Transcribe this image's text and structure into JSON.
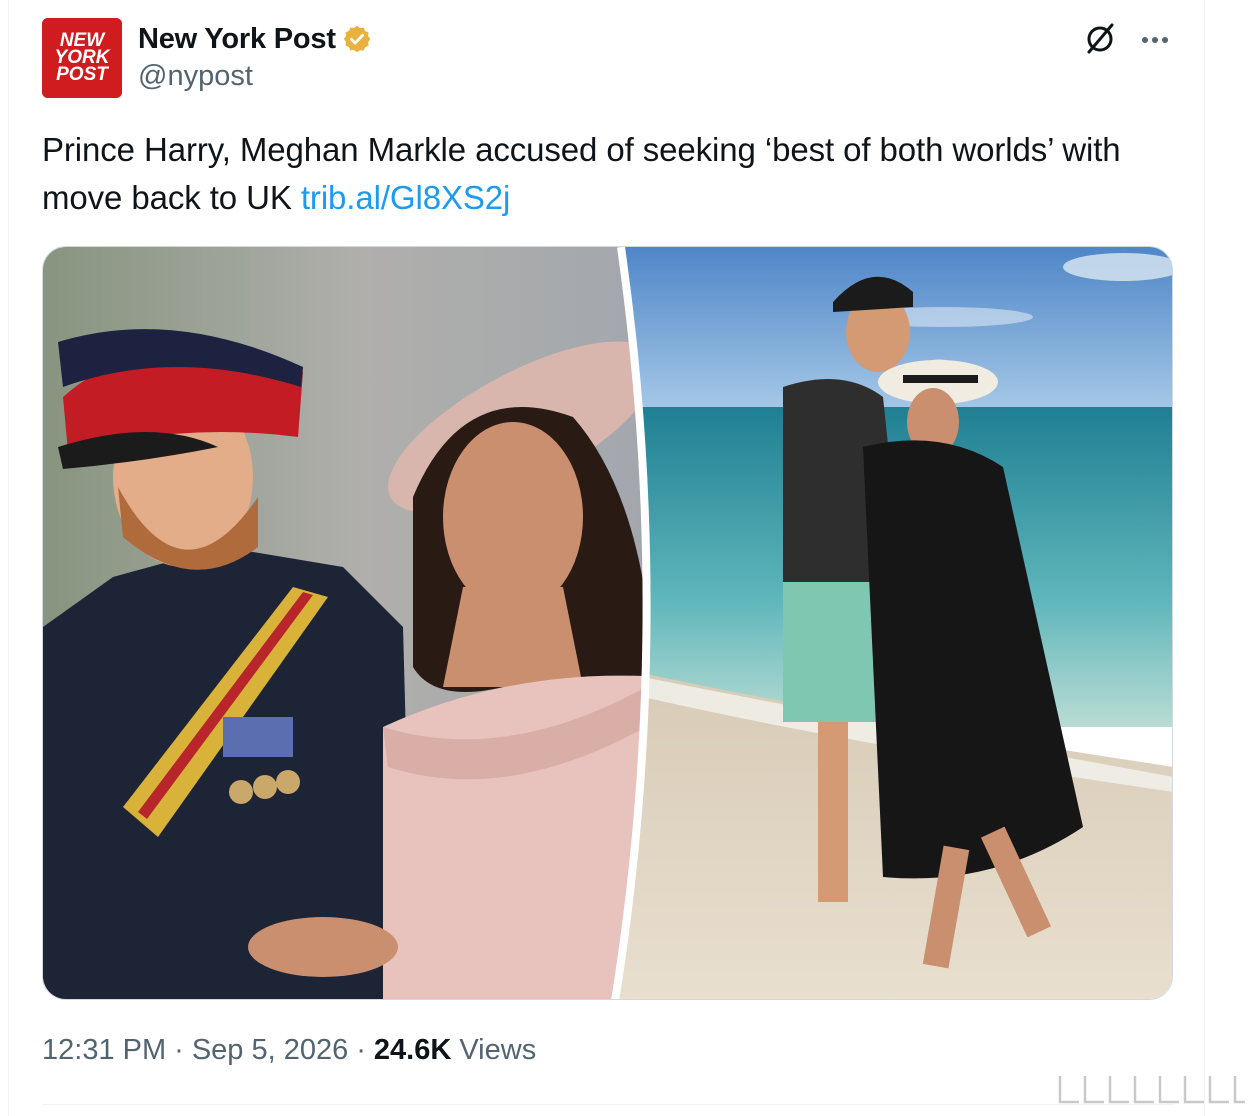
{
  "author": {
    "display_name": "New York Post",
    "handle": "@nypost",
    "verified": true,
    "avatar_lines": [
      "NEW",
      "YORK",
      "POST"
    ],
    "avatar_color": "#d01c1f",
    "verified_color": "#e8b23c"
  },
  "tweet": {
    "text": "Prince Harry, Meghan Markle accused of seeking ‘best of both worlds’ with move back to UK",
    "link": "trib.al/Gl8XS2j",
    "link_color": "#1d9bf0"
  },
  "media": {
    "panels": [
      "left-photo",
      "right-photo"
    ]
  },
  "meta": {
    "time": "12:31 PM",
    "separator": "·",
    "date": "Sep 5, 2026",
    "views_count": "24.6K",
    "views_label": "Views"
  },
  "icons": {
    "grok": "grok-icon",
    "more": "more-icon",
    "verified": "verified-badge-icon"
  }
}
